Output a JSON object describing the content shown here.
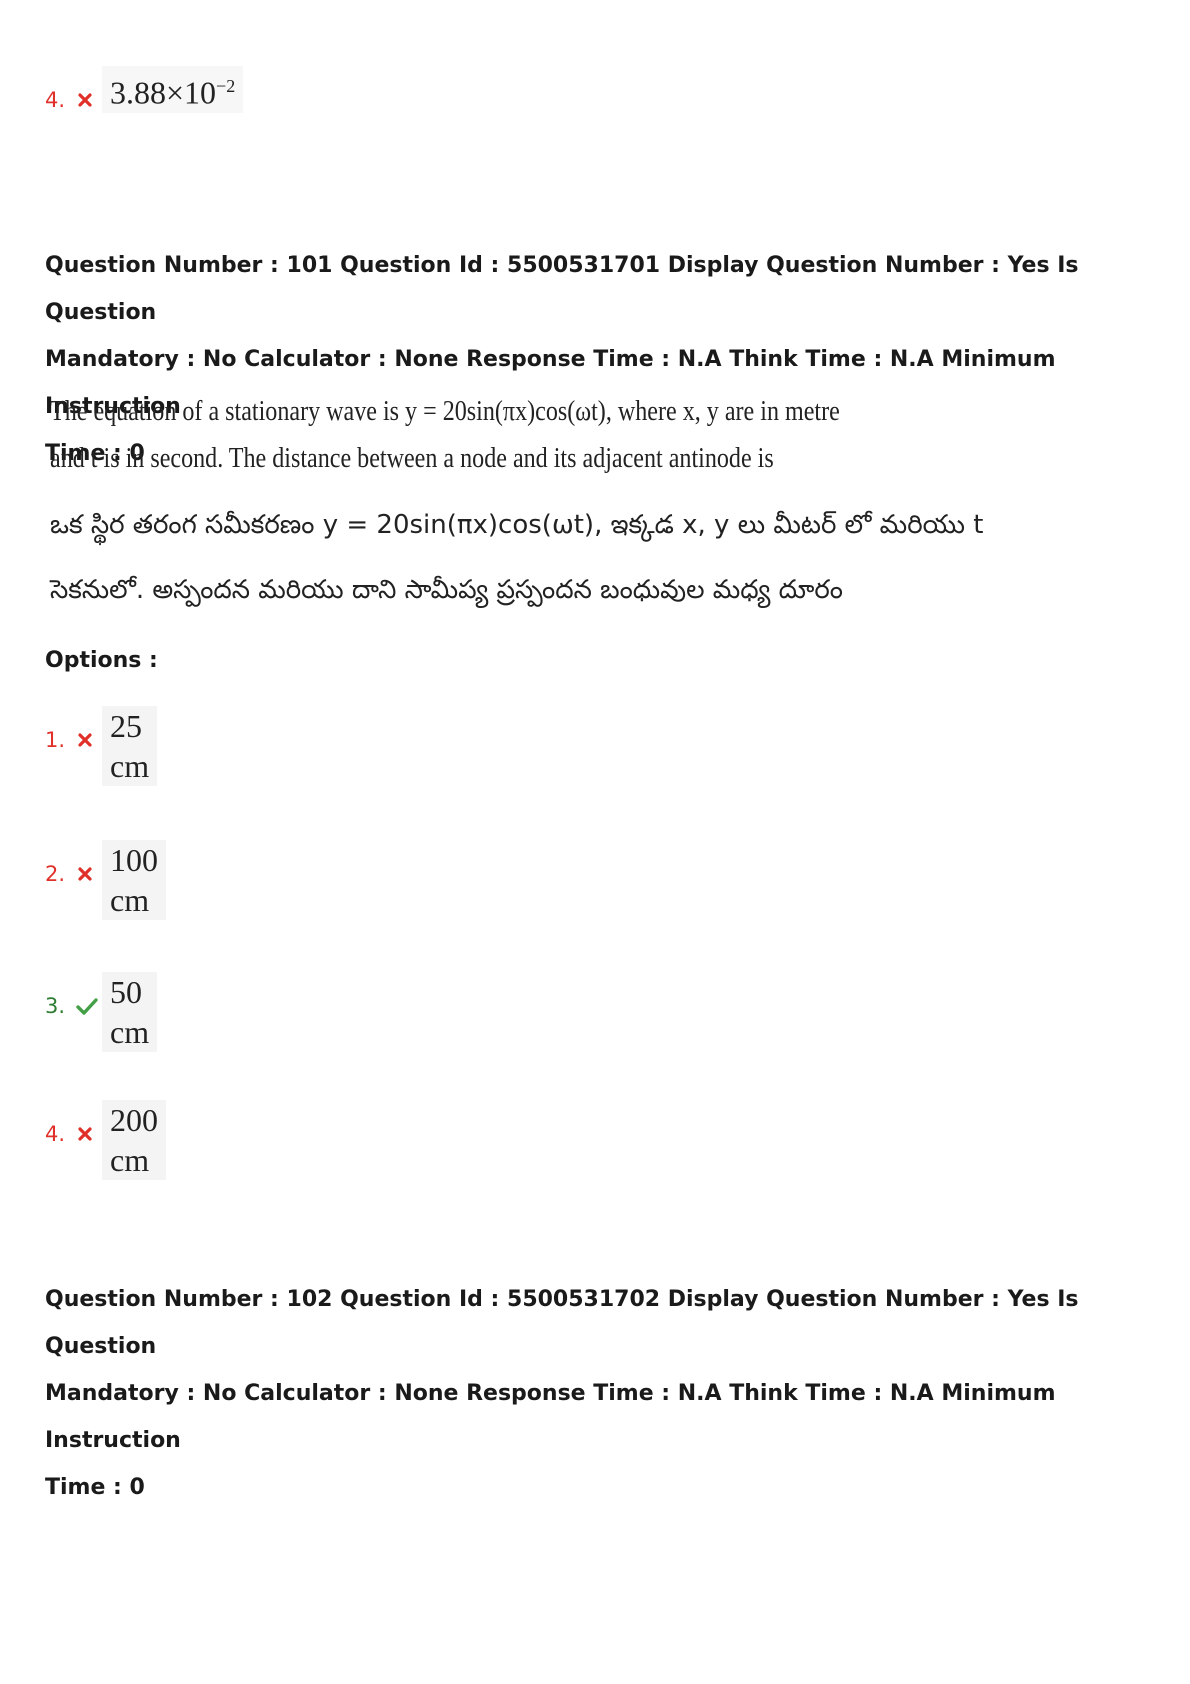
{
  "prev_option": {
    "number": "4.",
    "value": "3.88×10",
    "exponent": "−2",
    "status": "wrong"
  },
  "q101": {
    "meta_line1": "Question Number : 101 Question Id : 5500531701 Display Question Number : Yes Is Question",
    "meta_line2": "Mandatory : No Calculator : None Response Time : N.A Think Time : N.A Minimum Instruction",
    "meta_line3": "Time : 0",
    "text_en_line1": "The equation of a stationary wave is  y = 20sin(πx)cos(ωt),  where x, y are in metre",
    "text_en_line2": "and t is in second.  The distance between a node and its adjacent antinode is",
    "text_te_line1": "ఒక స్థిర తరంగ సమీకరణం  y = 20sin(πx)cos(ωt),  ఇక్కడ x, y లు మీటర్ లో మరియు t",
    "text_te_line2": "సెకనులో.  అస్పందన మరియు దాని సామీప్య ప్రస్పందన బంధువుల మధ్య దూరం",
    "options_label": "Options :",
    "options": [
      {
        "number": "1.",
        "value": "25 cm",
        "status": "wrong"
      },
      {
        "number": "2.",
        "value": "100 cm",
        "status": "wrong"
      },
      {
        "number": "3.",
        "value": "50 cm",
        "status": "correct"
      },
      {
        "number": "4.",
        "value": "200 cm",
        "status": "wrong"
      }
    ]
  },
  "q102": {
    "meta_line1": "Question Number : 102 Question Id : 5500531702 Display Question Number : Yes Is Question",
    "meta_line2": "Mandatory : No Calculator : None Response Time : N.A Think Time : N.A Minimum Instruction",
    "meta_line3": "Time : 0"
  },
  "colors": {
    "wrong": "#e0302a",
    "correct": "#43a047"
  }
}
